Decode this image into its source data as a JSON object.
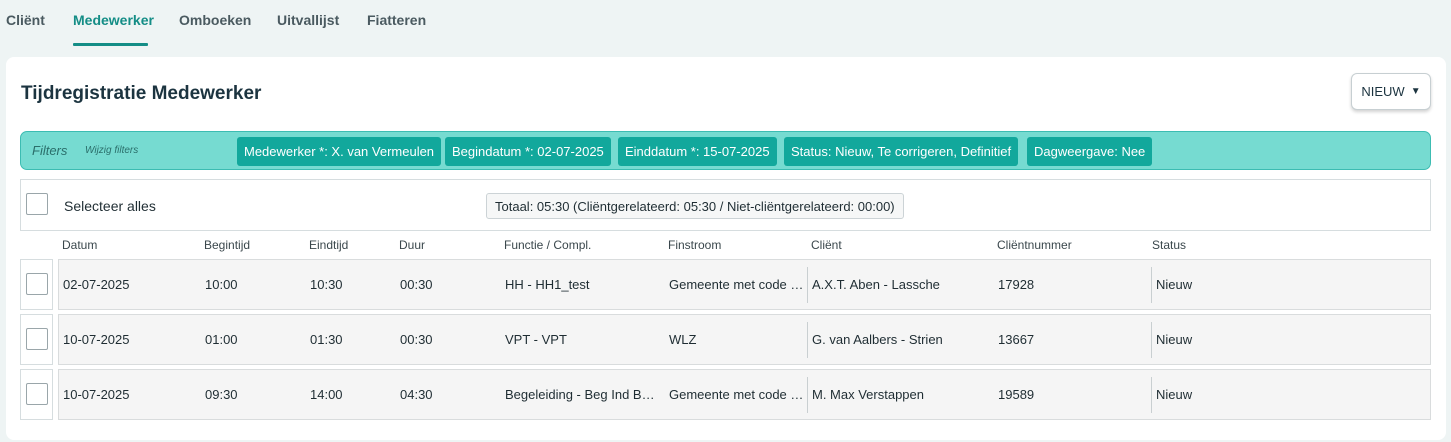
{
  "tabs": [
    {
      "label": "Cliënt",
      "active": false
    },
    {
      "label": "Medewerker",
      "active": true
    },
    {
      "label": "Omboeken",
      "active": false
    },
    {
      "label": "Uitvallijst",
      "active": false
    },
    {
      "label": "Fiatteren",
      "active": false
    }
  ],
  "page": {
    "title": "Tijdregistratie Medewerker",
    "new_button": "NIEUW",
    "new_button_icon": "caret-down-icon"
  },
  "filters": {
    "label": "Filters",
    "edit_link": "Wijzig filters",
    "chips": [
      "Medewerker *: X. van Vermeulen",
      "Begindatum *: 02-07-2025",
      "Einddatum *: 15-07-2025",
      "Status: Nieuw, Te corrigeren, Definitief",
      "Dagweergave: Nee"
    ]
  },
  "selection": {
    "select_all_label": "Selecteer alles",
    "total": "Totaal: 05:30 (Cliëntgerelateerd: 05:30 / Niet-cliëntgerelateerd: 00:00)"
  },
  "table": {
    "columns": [
      "Datum",
      "Begintijd",
      "Eindtijd",
      "Duur",
      "Functie / Compl.",
      "Finstroom",
      "Cliënt",
      "Cliëntnummer",
      "Status"
    ],
    "rows": [
      [
        "02-07-2025",
        "10:00",
        "10:30",
        "00:30",
        "HH - HH1_test",
        "Gemeente met code …",
        "A.X.T. Aben - Lassche",
        "17928",
        "Nieuw"
      ],
      [
        "10-07-2025",
        "01:00",
        "01:30",
        "00:30",
        "VPT - VPT",
        "WLZ",
        "G. van Aalbers - Strien",
        "13667",
        "Nieuw"
      ],
      [
        "10-07-2025",
        "09:30",
        "14:00",
        "04:30",
        "Begeleiding - Beg Ind Ba…",
        "Gemeente met code …",
        "M. Max Verstappen",
        "19589",
        "Nieuw"
      ]
    ]
  },
  "colors": {
    "accent": "#148d86",
    "filter_bar": "#76dbd1",
    "chip": "#12a89c"
  }
}
